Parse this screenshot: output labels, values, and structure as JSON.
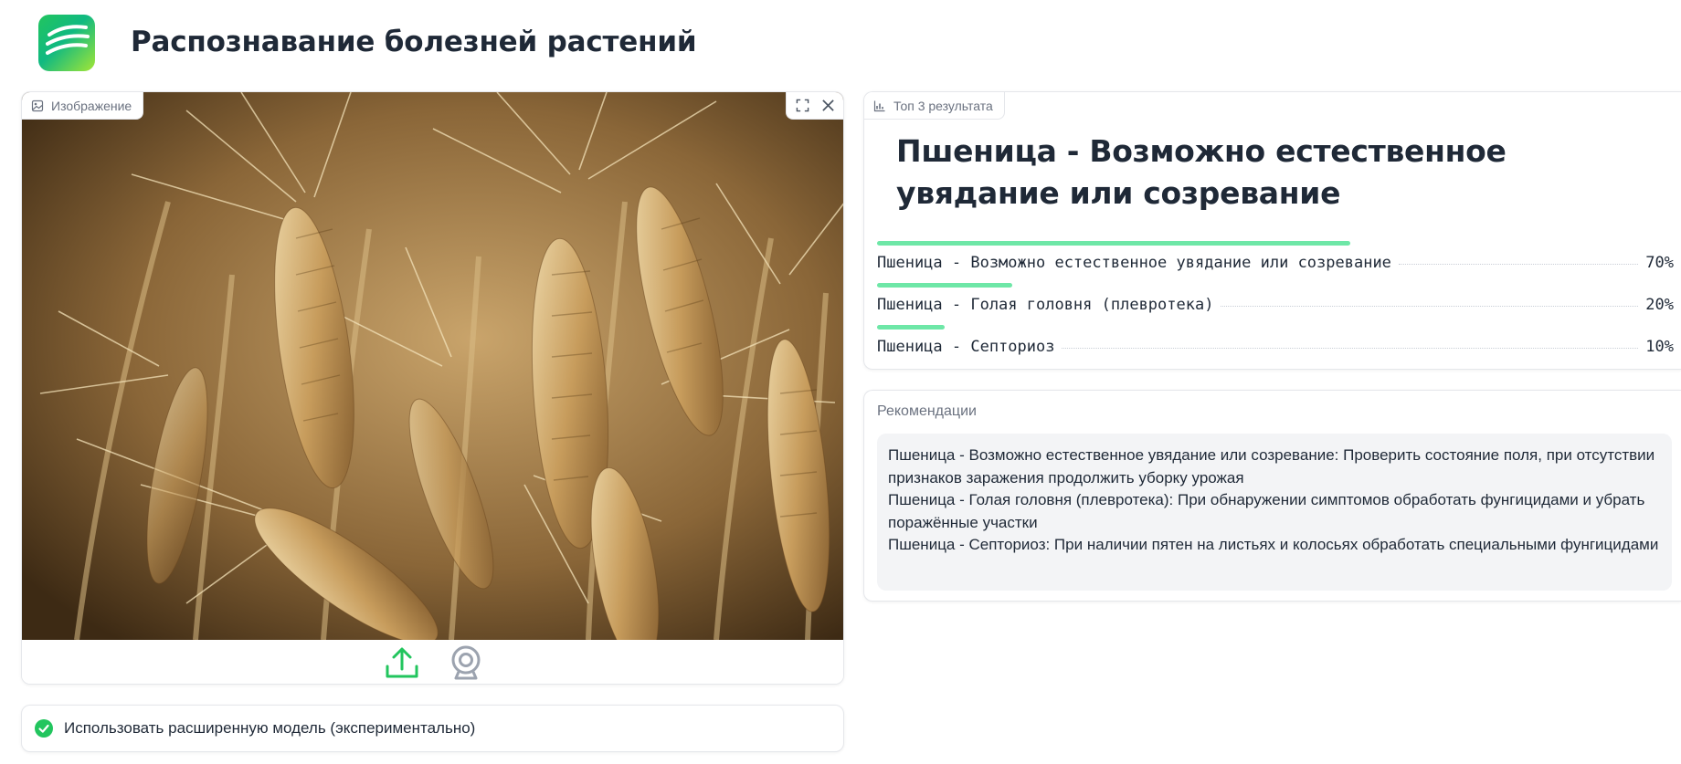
{
  "header": {
    "logo_icon": "app-logo-stripes-icon",
    "title": "Распознавание болезней растений"
  },
  "image_input": {
    "tab_label": "Изображение",
    "tab_icon": "image-icon",
    "image_content": "photo of ripe wheat ears",
    "tools": [
      {
        "icon": "fullscreen-icon"
      },
      {
        "icon": "close-icon"
      }
    ],
    "sources": [
      {
        "icon": "upload-icon",
        "active": true
      },
      {
        "icon": "webcam-icon",
        "active": false
      }
    ]
  },
  "checkbox": {
    "label": "Использовать расширенную модель (экспериментально)",
    "checked": true
  },
  "results": {
    "tab_label": "Топ 3 результата",
    "tab_icon": "bar-chart-icon",
    "headline": "Пшеница - Возможно естественное увядание или созревание",
    "items": [
      {
        "label": "Пшеница - Возможно естественное увядание или созревание",
        "percent": "70%",
        "confidence": 0.7
      },
      {
        "label": "Пшеница - Голая головня (плевротека)",
        "percent": "20%",
        "confidence": 0.2
      },
      {
        "label": "Пшеница - Септориоз",
        "percent": "10%",
        "confidence": 0.1
      }
    ]
  },
  "recommendations": {
    "title": "Рекомендации",
    "lines": [
      "Пшеница - Возможно естественное увядание или созревание: Проверить состояние поля, при отсутствии признаков заражения продолжить уборку урожая",
      "Пшеница - Голая головня (плевротека): При обнаружении симптомов обработать фунгицидами и убрать поражённые участки",
      "Пшеница - Септориоз: При наличии пятен на листьях и колосьях обработать специальными фунгицидами"
    ]
  },
  "colors": {
    "accent": "#22c55e",
    "result_bar": "#6ee7a7",
    "muted_text": "#6b7280",
    "reco_bg": "#f3f4f6"
  }
}
